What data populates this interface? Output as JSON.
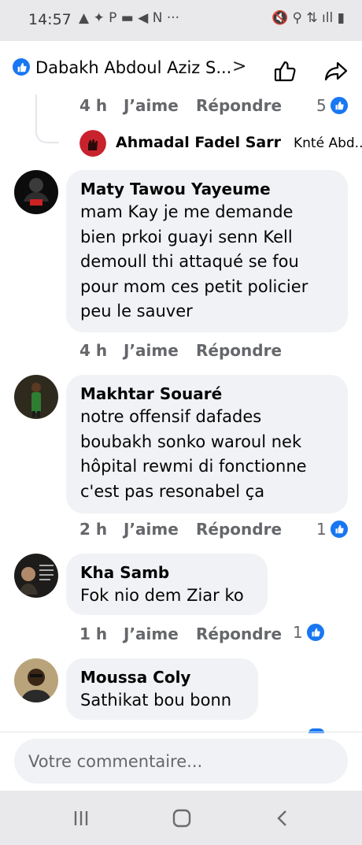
{
  "status_bar": {
    "time": "14:57",
    "left_icons": "▲ ✦ P ▬ ◀ N ···",
    "right_icons": "🔇 ⚲ ⇅ ıll ▮"
  },
  "header": {
    "title": "Dabakh Abdoul Aziz S...",
    "chevron": ">",
    "like_icon": "like-icon",
    "share_icon": "share-icon"
  },
  "top_actions": {
    "time": "4 h",
    "like": "J’aime",
    "reply": "Répondre",
    "reactions": "5"
  },
  "nested_reply": {
    "name": "Ahmadal Fadel Sarr",
    "preview": "Knté Abd..."
  },
  "comments": [
    {
      "name": "Maty Tawou Yayeume",
      "lines": [
        "mam Kay je me demande",
        "bien prkoi guayi senn Kell",
        "demoull thi attaqué se fou",
        "pour mom ces petit policier",
        "peu le sauver"
      ],
      "time": "4 h",
      "like": "J’aime",
      "reply": "Répondre",
      "reactions": ""
    },
    {
      "name": "Makhtar Souaré",
      "lines": [
        "notre offensif dafades",
        "boubakh sonko waroul nek",
        "hôpital rewmi di fonctionne",
        "c'est pas resonabel ça"
      ],
      "time": "2 h",
      "like": "J’aime",
      "reply": "Répondre",
      "reactions": "1"
    },
    {
      "name": "Kha Samb",
      "lines": [
        "Fok nio dem Ziar ko"
      ],
      "time": "1 h",
      "like": "J’aime",
      "reply": "Répondre",
      "reactions": "1"
    },
    {
      "name": "Moussa Coly",
      "lines": [
        "Sathikat bou bonn"
      ],
      "time": "",
      "like": "",
      "reply": "",
      "reactions": ""
    }
  ],
  "composer": {
    "placeholder": "Votre commentaire..."
  },
  "navbar": {
    "recents_icon": "recents-icon",
    "home_icon": "home-icon",
    "back_icon": "back-icon"
  },
  "colors": {
    "accent": "#1877f2",
    "bubble": "#f0f2f5",
    "meta": "#65676b"
  }
}
